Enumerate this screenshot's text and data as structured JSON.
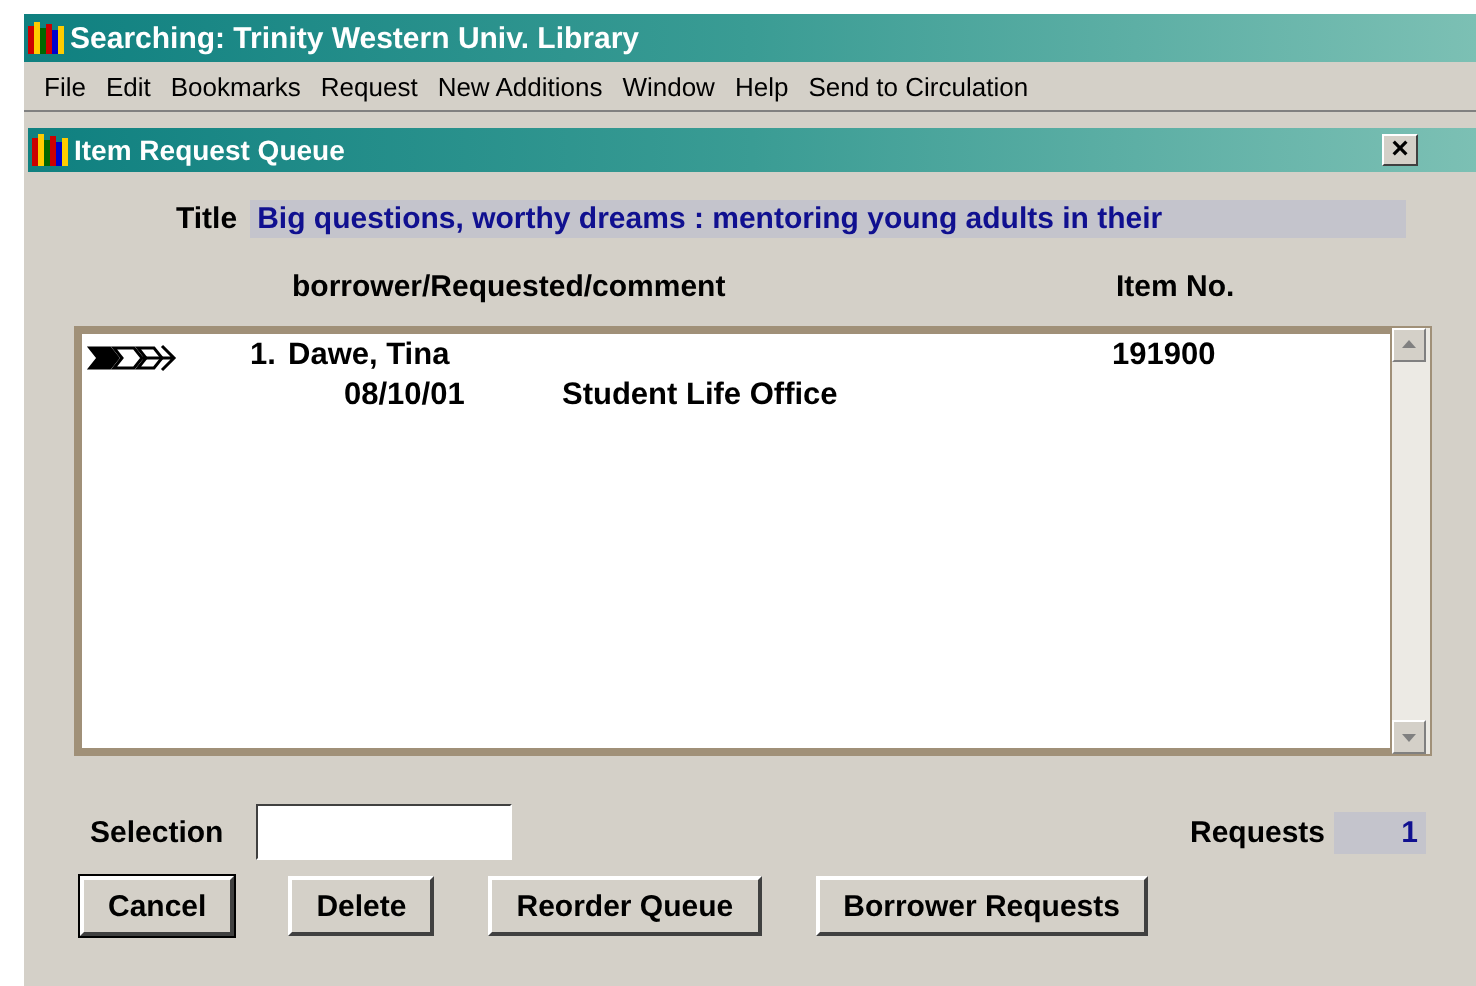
{
  "app_window": {
    "title": "Searching: Trinity Western Univ. Library"
  },
  "menu": [
    {
      "label": "File"
    },
    {
      "label": "Edit"
    },
    {
      "label": "Bookmarks"
    },
    {
      "label": "Request"
    },
    {
      "label": "New Additions"
    },
    {
      "label": "Window"
    },
    {
      "label": "Help"
    },
    {
      "label": "Send to Circulation"
    }
  ],
  "dialog": {
    "title": "Item Request Queue",
    "close": "×",
    "title_label": "Title",
    "title_value": "Big questions, worthy dreams : mentoring young adults in their",
    "columns": [
      "borrower/Requested/comment",
      "Item No."
    ],
    "requests": [
      {
        "selected": true,
        "number": "1.",
        "borrower": "Dawe, Tina",
        "item_no": "191900",
        "requested": "08/10/01",
        "comment": "Student Life Office"
      }
    ],
    "selection_label": "Selection",
    "requests_label": "Requests",
    "requests_count": "1",
    "buttons": [
      "Cancel",
      "Delete",
      "Reorder Queue",
      "Borrower Requests"
    ]
  }
}
